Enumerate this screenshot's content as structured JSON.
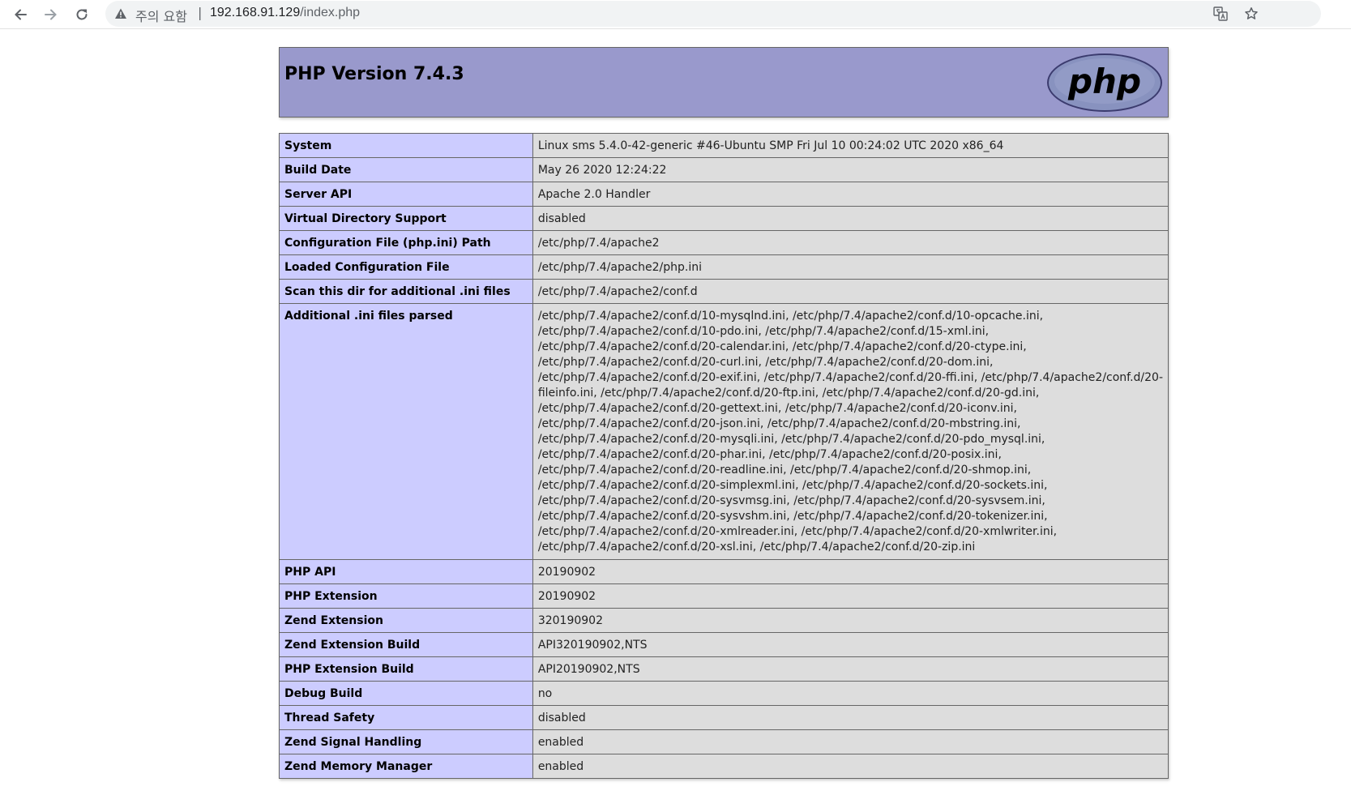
{
  "browser": {
    "security_label": "주의 요함",
    "separator": "|",
    "url_host": "192.168.91.129",
    "url_path": "/index.php"
  },
  "header": {
    "title": "PHP Version 7.4.3",
    "logo_text": "php"
  },
  "info_rows": [
    {
      "key": "System",
      "value": "Linux sms 5.4.0-42-generic #46-Ubuntu SMP Fri Jul 10 00:24:02 UTC 2020 x86_64"
    },
    {
      "key": "Build Date",
      "value": "May 26 2020 12:24:22"
    },
    {
      "key": "Server API",
      "value": "Apache 2.0 Handler"
    },
    {
      "key": "Virtual Directory Support",
      "value": "disabled"
    },
    {
      "key": "Configuration File (php.ini) Path",
      "value": "/etc/php/7.4/apache2"
    },
    {
      "key": "Loaded Configuration File",
      "value": "/etc/php/7.4/apache2/php.ini"
    },
    {
      "key": "Scan this dir for additional .ini files",
      "value": "/etc/php/7.4/apache2/conf.d"
    }
  ],
  "ini_files": {
    "key": "Additional .ini files parsed",
    "lines": [
      "/etc/php/7.4/apache2/conf.d/10-mysqlnd.ini, /etc/php/7.4/apache2/conf.d/10-opcache.ini,",
      "/etc/php/7.4/apache2/conf.d/10-pdo.ini, /etc/php/7.4/apache2/conf.d/15-xml.ini,",
      "/etc/php/7.4/apache2/conf.d/20-calendar.ini, /etc/php/7.4/apache2/conf.d/20-ctype.ini,",
      "/etc/php/7.4/apache2/conf.d/20-curl.ini, /etc/php/7.4/apache2/conf.d/20-dom.ini,",
      "/etc/php/7.4/apache2/conf.d/20-exif.ini, /etc/php/7.4/apache2/conf.d/20-ffi.ini, /etc/php/7.4/apache2/conf.d/20-",
      "fileinfo.ini, /etc/php/7.4/apache2/conf.d/20-ftp.ini, /etc/php/7.4/apache2/conf.d/20-gd.ini,",
      "/etc/php/7.4/apache2/conf.d/20-gettext.ini, /etc/php/7.4/apache2/conf.d/20-iconv.ini,",
      "/etc/php/7.4/apache2/conf.d/20-json.ini, /etc/php/7.4/apache2/conf.d/20-mbstring.ini,",
      "/etc/php/7.4/apache2/conf.d/20-mysqli.ini, /etc/php/7.4/apache2/conf.d/20-pdo_mysql.ini,",
      "/etc/php/7.4/apache2/conf.d/20-phar.ini, /etc/php/7.4/apache2/conf.d/20-posix.ini,",
      "/etc/php/7.4/apache2/conf.d/20-readline.ini, /etc/php/7.4/apache2/conf.d/20-shmop.ini,",
      "/etc/php/7.4/apache2/conf.d/20-simplexml.ini, /etc/php/7.4/apache2/conf.d/20-sockets.ini,",
      "/etc/php/7.4/apache2/conf.d/20-sysvmsg.ini, /etc/php/7.4/apache2/conf.d/20-sysvsem.ini,",
      "/etc/php/7.4/apache2/conf.d/20-sysvshm.ini, /etc/php/7.4/apache2/conf.d/20-tokenizer.ini,",
      "/etc/php/7.4/apache2/conf.d/20-xmlreader.ini, /etc/php/7.4/apache2/conf.d/20-xmlwriter.ini,",
      "/etc/php/7.4/apache2/conf.d/20-xsl.ini, /etc/php/7.4/apache2/conf.d/20-zip.ini"
    ]
  },
  "info_rows_2": [
    {
      "key": "PHP API",
      "value": "20190902"
    },
    {
      "key": "PHP Extension",
      "value": "20190902"
    },
    {
      "key": "Zend Extension",
      "value": "320190902"
    },
    {
      "key": "Zend Extension Build",
      "value": "API320190902,NTS"
    },
    {
      "key": "PHP Extension Build",
      "value": "API20190902,NTS"
    },
    {
      "key": "Debug Build",
      "value": "no"
    },
    {
      "key": "Thread Safety",
      "value": "disabled"
    },
    {
      "key": "Zend Signal Handling",
      "value": "enabled"
    },
    {
      "key": "Zend Memory Manager",
      "value": "enabled"
    }
  ],
  "colors": {
    "header_bg": "#9999cc",
    "key_cell_bg": "#ccccff",
    "value_cell_bg": "#dddddd"
  }
}
